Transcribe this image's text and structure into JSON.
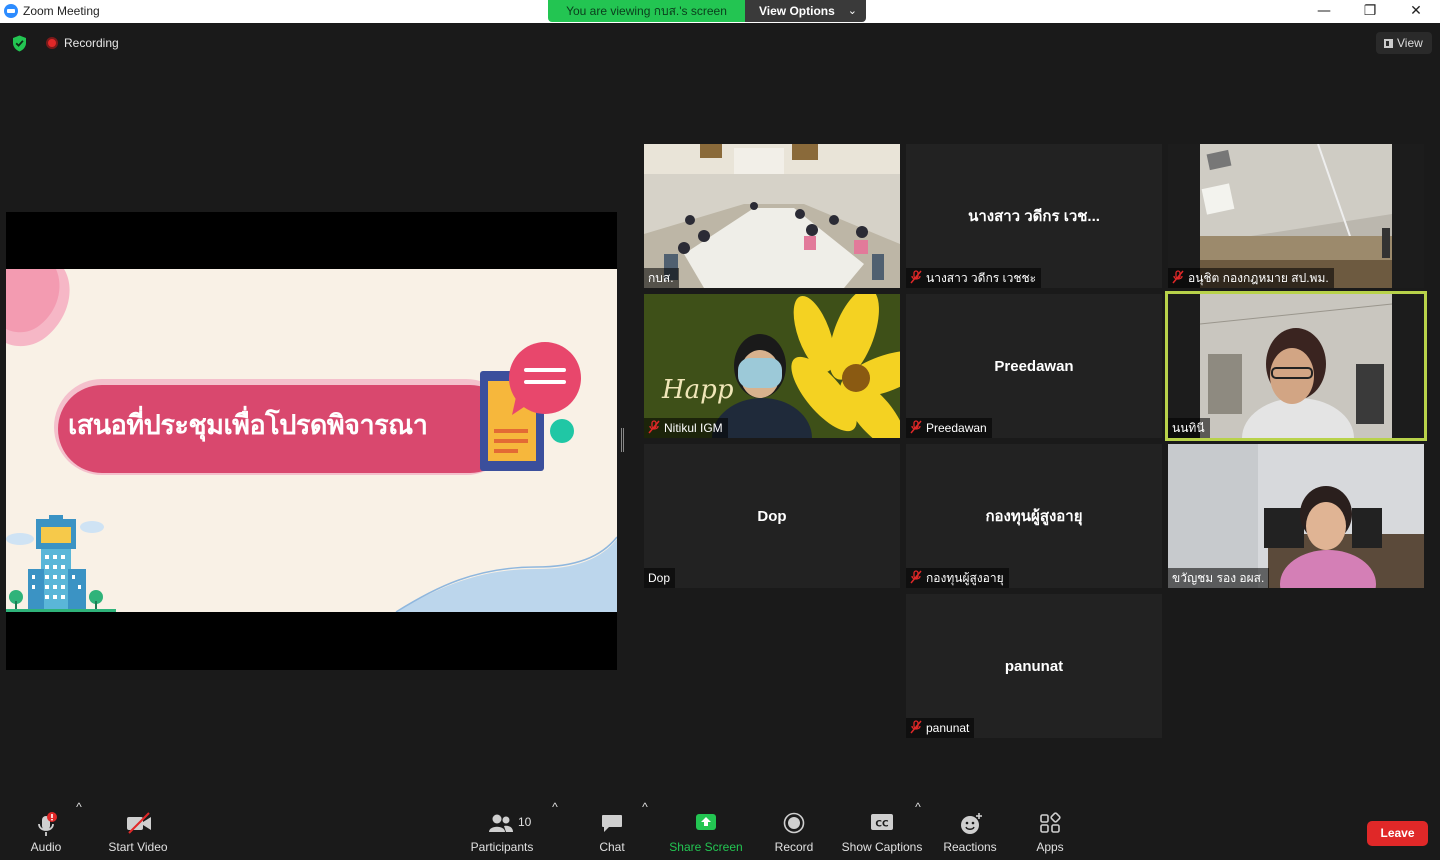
{
  "window": {
    "title": "Zoom Meeting",
    "minimize": "—",
    "maximize": "❐",
    "close": "✕"
  },
  "share_banner": {
    "text": "You are viewing กบส.'s screen",
    "view_options": "View Options",
    "chevron": "⌄"
  },
  "status": {
    "recording_label": "Recording",
    "view_label": "View"
  },
  "shared_screen": {
    "slide_title": "เสนอที่ประชุมเพื่อโปรดพิจารณา"
  },
  "participants": [
    {
      "label": "กบส.",
      "center_name": "",
      "muted": false,
      "video": true
    },
    {
      "label": "นางสาว วดีกร เวชชะ",
      "center_name": "นางสาว วดีกร เวช...",
      "muted": true,
      "video": false
    },
    {
      "label": "อนุชิต กองกฎหมาย สป.พม.",
      "center_name": "",
      "muted": true,
      "video": true
    },
    {
      "label": "Nitikul IGM",
      "center_name": "",
      "muted": true,
      "video": true
    },
    {
      "label": "Preedawan",
      "center_name": "Preedawan",
      "muted": true,
      "video": false
    },
    {
      "label": "นนทินี",
      "center_name": "",
      "muted": false,
      "video": true
    },
    {
      "label": "Dop",
      "center_name": "Dop",
      "muted": false,
      "video": false
    },
    {
      "label": "กองทุนผู้สูงอายุ",
      "center_name": "กองทุนผู้สูงอายุ",
      "muted": true,
      "video": false
    },
    {
      "label": "ขวัญชม รอง อผส.",
      "center_name": "",
      "muted": false,
      "video": true
    },
    {
      "label": "panunat",
      "center_name": "panunat",
      "muted": true,
      "video": false
    }
  ],
  "toolbar": {
    "audio": "Audio",
    "start_video": "Start Video",
    "participants": "Participants",
    "participant_count": "10",
    "chat": "Chat",
    "share_screen": "Share Screen",
    "record": "Record",
    "show_captions": "Show Captions",
    "reactions": "Reactions",
    "apps": "Apps",
    "leave": "Leave",
    "caret": "^"
  },
  "colors": {
    "background": "#1a1a1a",
    "tile": "#222222",
    "share_green": "#23c552",
    "leave_red": "#e02828",
    "active_speaker": "#b8d24a",
    "slide_pink": "#d9486e"
  },
  "icons": [
    "zoom-logo-icon",
    "shield-icon",
    "record-dot-icon",
    "grid-icon",
    "mic-muted-icon",
    "video-off-icon",
    "participants-icon",
    "chat-icon",
    "share-screen-icon",
    "record-icon",
    "cc-icon",
    "reactions-icon",
    "apps-icon"
  ]
}
